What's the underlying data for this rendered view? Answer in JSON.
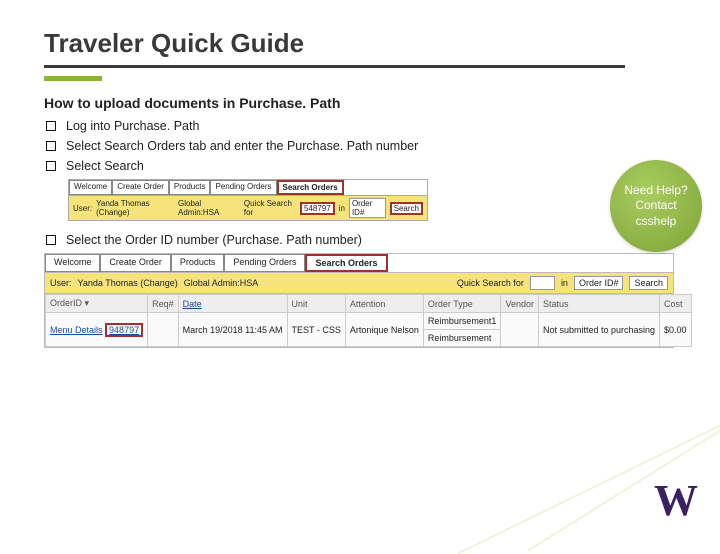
{
  "title": "Traveler Quick Guide",
  "subtitle": "How to upload documents in Purchase. Path",
  "steps": {
    "s1": "Log into Purchase. Path",
    "s2": "Select Search Orders tab and enter the Purchase. Path number",
    "s3": "Select Search",
    "s4": "Select the Order ID number (Purchase. Path number)"
  },
  "help": "Need Help? Contact csshelp",
  "shot1": {
    "tabs": {
      "t1": "Welcome",
      "t2": "Create Order",
      "t3": "Products",
      "t4": "Pending Orders",
      "t5": "Search Orders"
    },
    "user_label": "User:",
    "user_value": "Yanda Thomas (Change)",
    "role": "Global Admin:HSA",
    "qs_label": "Quick Search for",
    "qs_value": "548797",
    "in_label": "in",
    "order_field": "Order ID#",
    "search_btn": "Search"
  },
  "shot2": {
    "tabs": {
      "t1": "Welcome",
      "t2": "Create Order",
      "t3": "Products",
      "t4": "Pending Orders",
      "t5": "Search Orders"
    },
    "user_label": "User:",
    "user_value": "Yanda Thomas (Change)",
    "role": "Global Admin:HSA",
    "qs_label": "Quick Search for",
    "in_label": "in",
    "order_field": "Order ID#",
    "search_btn": "Search",
    "cols": {
      "c1": "OrderID ▾",
      "c2": "Req#",
      "c3": "Date",
      "c4": "Unit",
      "c5": "Attention",
      "c6": "Order Type",
      "c7": "Vendor",
      "c8": "Status",
      "c9": "Cost"
    },
    "menu_link": "Menu Details",
    "row": {
      "orderid": "948797",
      "req": "",
      "date": "March 19/2018 11:45 AM",
      "unit": "TEST - CSS",
      "attention": "Artonique Nelson",
      "ordertype_top": "Reimbursement1",
      "ordertype_bot": "Reimbursement",
      "vendor": "",
      "status": "Not submitted to purchasing",
      "cost": "$0.00"
    }
  },
  "logo": "W"
}
